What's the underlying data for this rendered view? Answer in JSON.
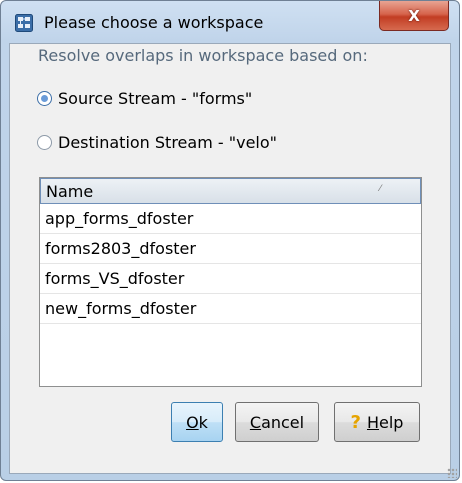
{
  "window": {
    "title": "Please choose a workspace",
    "close_glyph": "X",
    "close_color": "#c8452b"
  },
  "prompt": "Resolve overlaps in workspace based on:",
  "radios": [
    {
      "label": "Source Stream - \"forms\"",
      "checked": true
    },
    {
      "label": "Destination Stream - \"velo\"",
      "checked": false
    }
  ],
  "table": {
    "header": "Name",
    "rows": [
      "app_forms_dfoster",
      "forms2803_dfoster",
      "forms_VS_dfoster",
      "new_forms_dfoster"
    ]
  },
  "buttons": {
    "ok": {
      "mnemonic": "O",
      "rest": "k"
    },
    "cancel": {
      "mnemonic": "C",
      "rest": "ancel"
    },
    "help": {
      "mnemonic": "H",
      "rest": "elp",
      "icon": "?"
    }
  },
  "colors": {
    "accent": "#3c7fb1",
    "prompt_text": "#56697c"
  }
}
